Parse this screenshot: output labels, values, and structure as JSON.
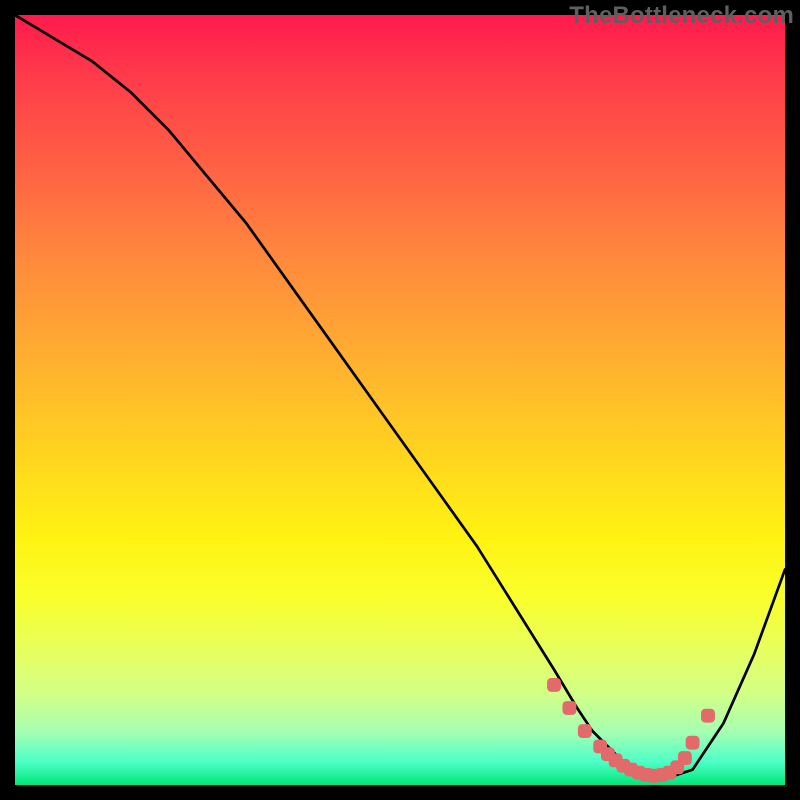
{
  "watermark": "TheBottleneck.com",
  "chart_data": {
    "type": "line",
    "title": "",
    "xlabel": "",
    "ylabel": "",
    "xlim": [
      0,
      100
    ],
    "ylim": [
      0,
      100
    ],
    "grid": false,
    "legend": false,
    "series": [
      {
        "name": "black-curve",
        "color": "#000000",
        "x": [
          0,
          5,
          10,
          15,
          20,
          25,
          30,
          35,
          40,
          45,
          50,
          55,
          60,
          65,
          70,
          73,
          75,
          78,
          80,
          82,
          85,
          88,
          92,
          96,
          100
        ],
        "y": [
          100,
          97,
          94,
          90,
          85,
          79,
          73,
          66,
          59,
          52,
          45,
          38,
          31,
          23,
          15,
          10,
          7,
          4,
          2,
          1,
          1,
          2,
          8,
          17,
          28
        ]
      },
      {
        "name": "pink-trough-markers",
        "color": "#e26a6a",
        "x": [
          70,
          72,
          74,
          76,
          77,
          78,
          79,
          80,
          81,
          82,
          83,
          84,
          85,
          86,
          87,
          88,
          90
        ],
        "y": [
          13,
          10,
          7,
          5,
          4,
          3.2,
          2.5,
          2,
          1.6,
          1.3,
          1.2,
          1.3,
          1.6,
          2.3,
          3.5,
          5.5,
          9
        ]
      }
    ],
    "gradient_stops": [
      {
        "pos": 0.0,
        "color": "#ff1a4d"
      },
      {
        "pos": 0.08,
        "color": "#ff3b4a"
      },
      {
        "pos": 0.2,
        "color": "#ff6244"
      },
      {
        "pos": 0.32,
        "color": "#ff8a3c"
      },
      {
        "pos": 0.45,
        "color": "#ffb030"
      },
      {
        "pos": 0.57,
        "color": "#ffd41f"
      },
      {
        "pos": 0.68,
        "color": "#fff312"
      },
      {
        "pos": 0.76,
        "color": "#f9ff2e"
      },
      {
        "pos": 0.82,
        "color": "#e9ff5a"
      },
      {
        "pos": 0.88,
        "color": "#d3ff85"
      },
      {
        "pos": 0.93,
        "color": "#a6ffb0"
      },
      {
        "pos": 0.97,
        "color": "#4dffc8"
      },
      {
        "pos": 1.0,
        "color": "#00e876"
      }
    ]
  }
}
